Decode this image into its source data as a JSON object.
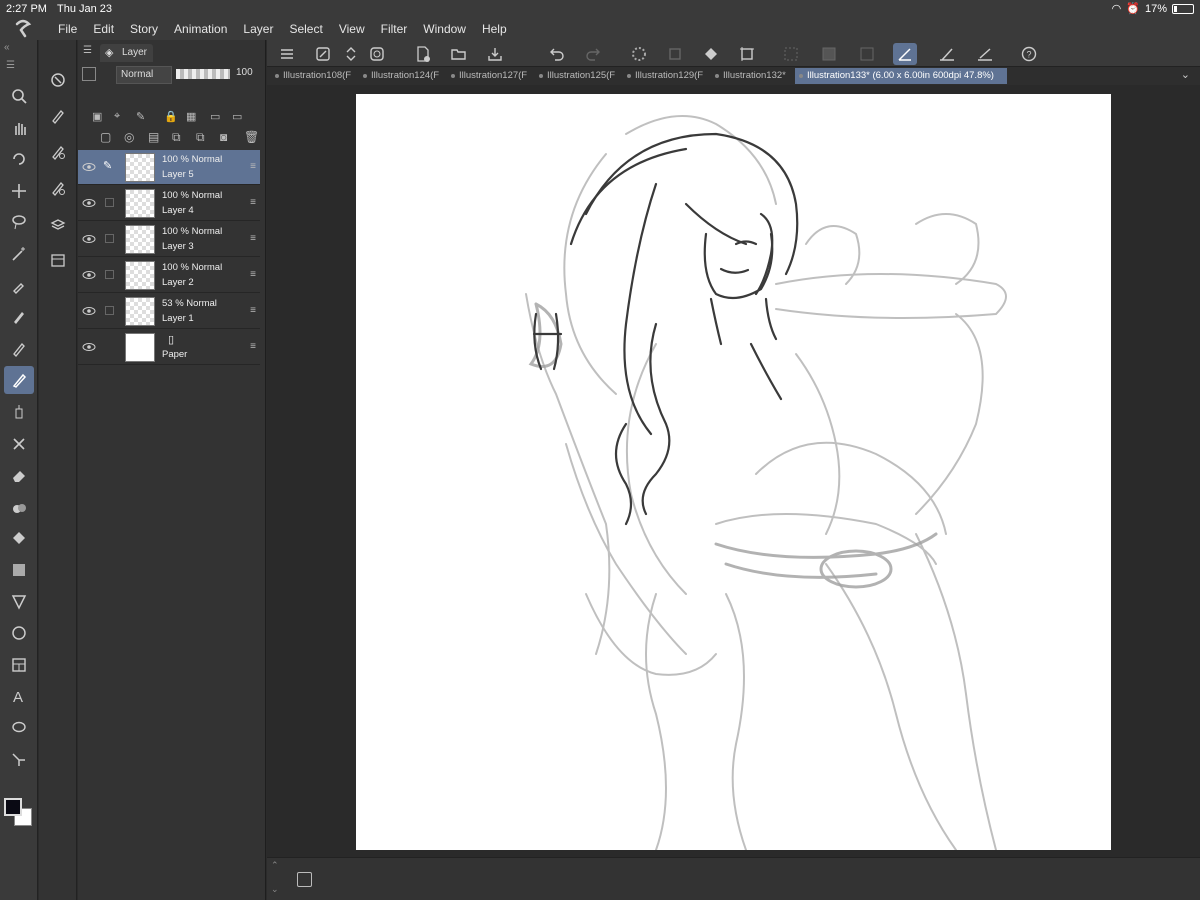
{
  "status": {
    "time": "2:27 PM",
    "date": "Thu Jan 23",
    "battery": "17%",
    "battery_level": 0.17
  },
  "menu": [
    "File",
    "Edit",
    "Story",
    "Animation",
    "Layer",
    "Select",
    "View",
    "Filter",
    "Window",
    "Help"
  ],
  "tools": [
    "zoom-icon",
    "hand-icon",
    "rotate-icon",
    "move-icon",
    "lasso-icon",
    "magic-wand-icon",
    "eyedropper-icon",
    "pen-icon",
    "pencil-icon",
    "brush-icon",
    "airbrush-icon",
    "decoration-icon",
    "eraser-icon",
    "blend-icon",
    "fill-icon",
    "gradient-icon",
    "figure-icon",
    "ellipse-icon",
    "frame-icon",
    "text-icon",
    "balloon-icon",
    "line-edit-icon"
  ],
  "active_tool": "brush-icon",
  "layer_panel": {
    "tab_label": "Layer",
    "blend_mode": "Normal",
    "opacity": "100",
    "layers": [
      {
        "opacity": "100 %",
        "mode": "Normal",
        "name": "Layer 5",
        "selected": true
      },
      {
        "opacity": "100 %",
        "mode": "Normal",
        "name": "Layer 4",
        "selected": false
      },
      {
        "opacity": "100 %",
        "mode": "Normal",
        "name": "Layer 3",
        "selected": false
      },
      {
        "opacity": "100 %",
        "mode": "Normal",
        "name": "Layer 2",
        "selected": false
      },
      {
        "opacity": "53 %",
        "mode": "Normal",
        "name": "Layer 1",
        "selected": false
      },
      {
        "opacity": "",
        "mode": "",
        "name": "Paper",
        "selected": false
      }
    ]
  },
  "doc_tabs": [
    {
      "label": "Illustration108(F",
      "active": false
    },
    {
      "label": "Illustration124(F",
      "active": false
    },
    {
      "label": "Illustration127(F",
      "active": false
    },
    {
      "label": "Illustration125(F",
      "active": false
    },
    {
      "label": "Illustration129(F",
      "active": false
    },
    {
      "label": "Illustration132*",
      "active": false
    },
    {
      "label": "Illustration133* (6.00 x 6.00in 600dpi 47.8%)",
      "active": true
    }
  ],
  "colors": {
    "panel": "#3a3a3a",
    "accent": "#5f7394",
    "canvas": "#ffffff"
  }
}
